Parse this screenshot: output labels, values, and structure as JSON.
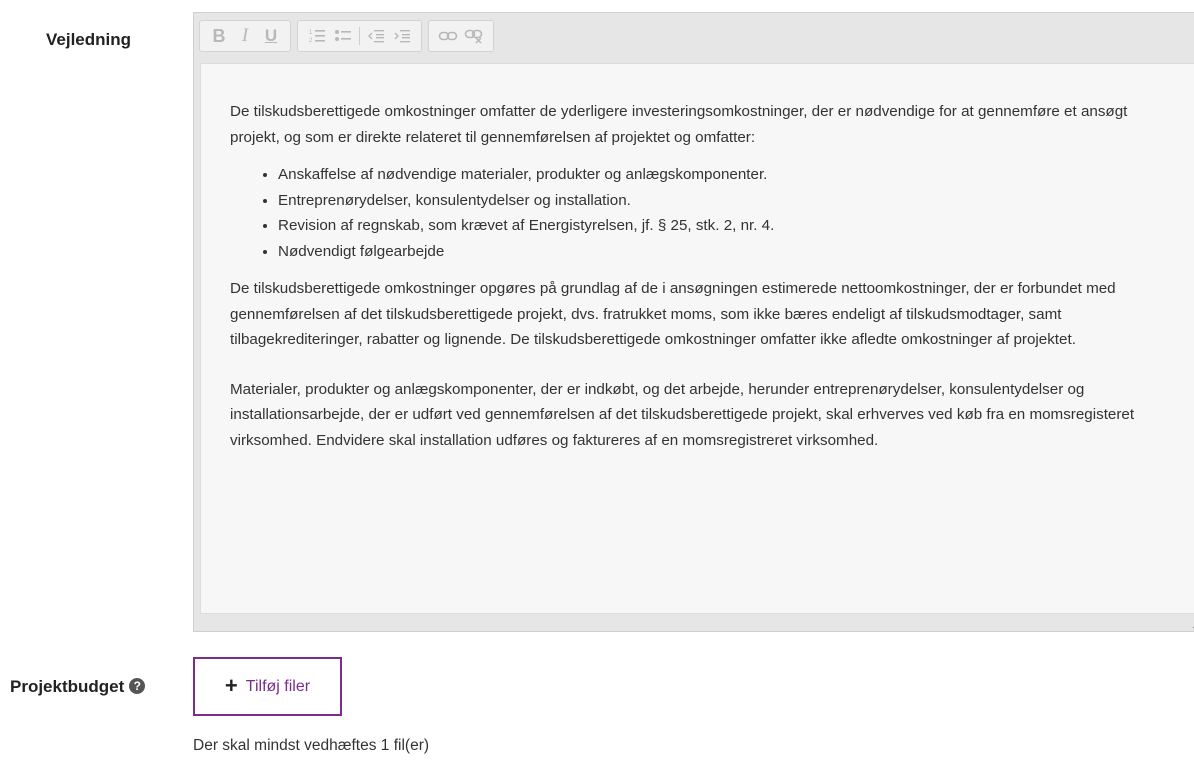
{
  "guidance": {
    "label": "Vejledning",
    "paragraph1": "De tilskudsberettigede omkostninger omfatter de yderligere investeringsomkostninger, der er nødvendige for at gennemføre et ansøgt projekt, og som er direkte relateret til gennemførelsen af projektet og omfatter:",
    "bullets": [
      "Anskaffelse af nødvendige materialer, produkter og anlægskomponenter.",
      "Entreprenørydelser, konsulentydelser og installation.",
      "Revision af regnskab, som krævet af Energistyrelsen, jf. § 25, stk. 2, nr. 4.",
      "Nødvendigt følgearbejde"
    ],
    "paragraph2": "De tilskudsberettigede omkostninger opgøres på grundlag af de i ansøgningen estimerede nettoomkostninger, der er forbundet med gennemførelsen af det tilskudsberettigede projekt, dvs. fratrukket moms, som ikke bæres endeligt af tilskudsmodtager, samt tilbagekrediteringer, rabatter og lignende. De tilskudsberettigede omkostninger omfatter ikke afledte omkostninger af projektet.",
    "paragraph3": "Materialer, produkter og anlægskomponenter, der er indkøbt, og det arbejde, herunder entreprenørydelser, konsulentydelser og installationsarbejde, der er udført ved gennemførelsen af det tilskudsberettigede projekt, skal erhverves ved køb fra en momsregisteret virksomhed. Endvidere skal installation udføres og faktureres af en momsregistreret virksomhed."
  },
  "toolbar": {
    "bold": "B",
    "italic": "I",
    "underline": "U"
  },
  "budget": {
    "label": "Projektbudget",
    "help_glyph": "?",
    "add_button_icon": "+",
    "add_button_label": "Tilføj filer",
    "hint": "Der skal mindst vedhæftes 1 fil(er)"
  },
  "colors": {
    "accent": "#7a2d8a",
    "toolbar_disabled": "#b8b8b8"
  },
  "icons": {
    "bold": "bold-icon",
    "italic": "italic-icon",
    "underline": "underline-icon",
    "ordered_list": "ordered-list-icon",
    "bullet_list": "bullet-list-icon",
    "outdent": "outdent-icon",
    "indent": "indent-icon",
    "link": "link-icon",
    "unlink": "unlink-icon",
    "help": "help-circle-icon",
    "plus": "plus-icon"
  }
}
